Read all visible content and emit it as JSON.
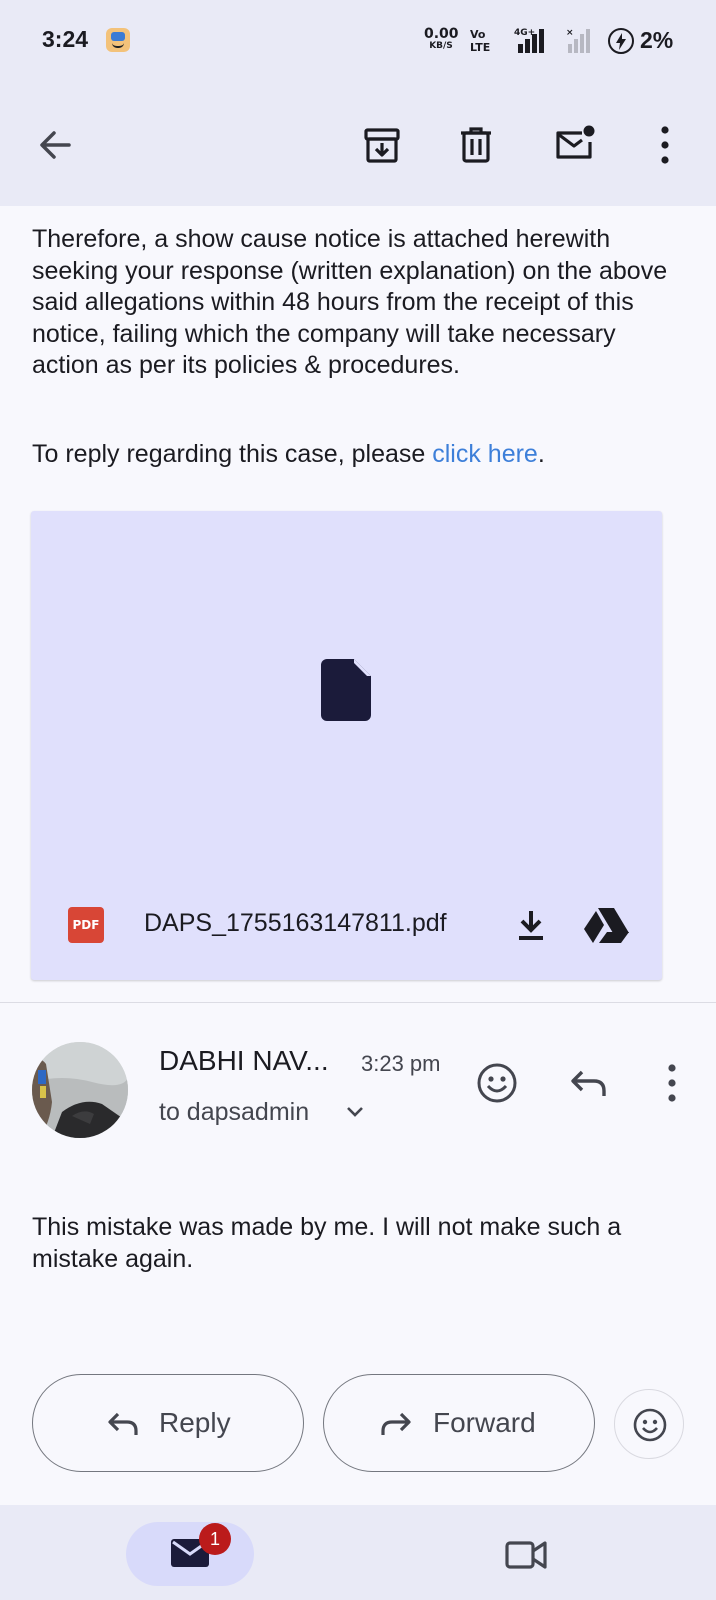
{
  "status_bar": {
    "time": "3:24",
    "net_speed_value": "0.00",
    "net_speed_unit": "KB/S",
    "volte_top": "Vo",
    "volte_bottom": "LTE",
    "sim1_tag": "4G+",
    "sim2_tag": "×",
    "battery_percent": "2%"
  },
  "toolbar": {
    "icons": [
      "back-arrow-icon",
      "archive-icon",
      "delete-icon",
      "mark-unread-icon",
      "more-vert-icon"
    ]
  },
  "email": {
    "paragraph1": "Therefore, a show cause notice is attached herewith seeking your response (written explanation) on the above said allegations within 48 hours from the receipt of this notice, failing which the company will take necessary action as per its policies & procedures.",
    "paragraph2_prefix": "To reply regarding this case, please ",
    "paragraph2_link": "click here",
    "paragraph2_suffix": "."
  },
  "attachment": {
    "type_badge": "PDF",
    "filename": "DAPS_1755163147811.pdf"
  },
  "reply_message": {
    "sender": "DABHI NAV...",
    "time": "3:23 pm",
    "recipient": "to dapsadmin",
    "body": "This mistake was made by me. I will not make such a mistake again."
  },
  "actions": {
    "reply_label": "Reply",
    "forward_label": "Forward"
  },
  "bottom_nav": {
    "mail_badge": "1"
  },
  "colors": {
    "surface": "#f8f8fd",
    "bar": "#e9eaf6",
    "attachment_bg": "#e0e0fc",
    "link": "#3d7fd9",
    "pdf_badge": "#d84636",
    "badge": "#bb1b1b"
  }
}
